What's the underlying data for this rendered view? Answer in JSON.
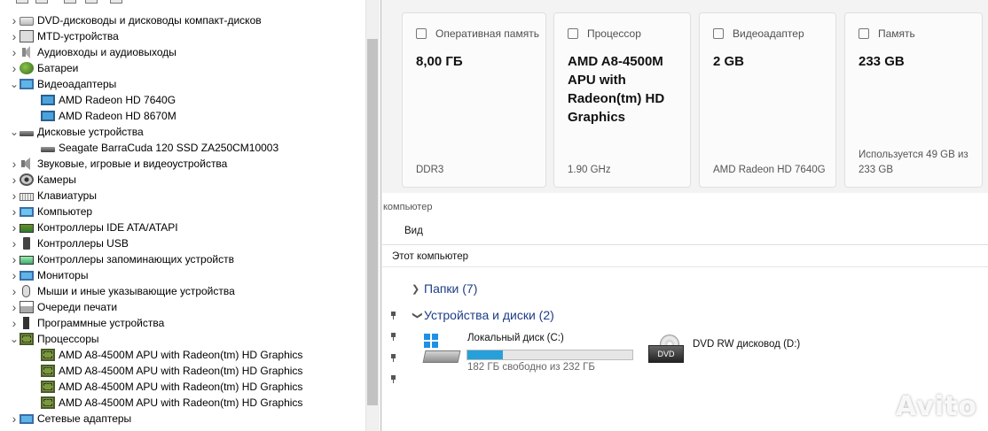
{
  "device_manager": {
    "categories": [
      {
        "label": "DVD-дисководы и дисководы компакт-дисков",
        "icon": "dvd-drive-icon",
        "expanded": false
      },
      {
        "label": "MTD-устройства",
        "icon": "mtd-icon",
        "expanded": false
      },
      {
        "label": "Аудиовходы и аудиовыходы",
        "icon": "audio-io-icon",
        "expanded": false
      },
      {
        "label": "Батареи",
        "icon": "battery-icon",
        "expanded": false
      },
      {
        "label": "Видеоадаптеры",
        "icon": "display-adapter-icon",
        "expanded": true,
        "children": [
          "AMD Radeon HD 7640G",
          "AMD Radeon HD 8670M"
        ]
      },
      {
        "label": "Дисковые устройства",
        "icon": "disk-drive-icon",
        "expanded": true,
        "children": [
          "Seagate BarraCuda 120 SSD ZA250CM10003"
        ]
      },
      {
        "label": "Звуковые, игровые и видеоустройства",
        "icon": "sound-icon",
        "expanded": false
      },
      {
        "label": "Камеры",
        "icon": "camera-icon",
        "expanded": false
      },
      {
        "label": "Клавиатуры",
        "icon": "keyboard-icon",
        "expanded": false
      },
      {
        "label": "Компьютер",
        "icon": "computer-icon",
        "expanded": false
      },
      {
        "label": "Контроллеры IDE ATA/ATAPI",
        "icon": "ide-controller-icon",
        "expanded": false
      },
      {
        "label": "Контроллеры USB",
        "icon": "usb-icon",
        "expanded": false
      },
      {
        "label": "Контроллеры запоминающих устройств",
        "icon": "storage-controller-icon",
        "expanded": false
      },
      {
        "label": "Мониторы",
        "icon": "monitor-icon",
        "expanded": false
      },
      {
        "label": "Мыши и иные указывающие устройства",
        "icon": "mouse-icon",
        "expanded": false
      },
      {
        "label": "Очереди печати",
        "icon": "print-queue-icon",
        "expanded": false
      },
      {
        "label": "Программные устройства",
        "icon": "software-device-icon",
        "expanded": false
      },
      {
        "label": "Процессоры",
        "icon": "processor-icon",
        "expanded": true,
        "children": [
          "AMD A8-4500M APU with Radeon(tm) HD Graphics",
          "AMD A8-4500M APU with Radeon(tm) HD Graphics",
          "AMD A8-4500M APU with Radeon(tm) HD Graphics",
          "AMD A8-4500M APU with Radeon(tm) HD Graphics"
        ]
      },
      {
        "label": "Сетевые адаптеры",
        "icon": "network-adapter-icon",
        "expanded": false
      }
    ]
  },
  "system_cards": [
    {
      "id": "ram",
      "title": "Оперативная память",
      "icon": "memory-icon",
      "value": "8,00 ГБ",
      "footer": "DDR3"
    },
    {
      "id": "cpu",
      "title": "Процессор",
      "icon": "processor-icon",
      "value": "AMD A8-4500M APU with Radeon(tm) HD Graphics",
      "footer": "1.90 GHz"
    },
    {
      "id": "gpu",
      "title": "Видеоадаптер",
      "icon": "video-adapter-icon",
      "value": "2 GB",
      "footer": "AMD Radeon HD 7640G"
    },
    {
      "id": "storage",
      "title": "Память",
      "icon": "storage-icon",
      "value": "233 GB",
      "footer": "Используется 49 GB из 233 GB"
    }
  ],
  "explorer": {
    "window_title": "компьютер",
    "menu_view": "Вид",
    "address": "Этот компьютер",
    "groups": {
      "folders": "Папки (7)",
      "devices": "Устройства и диски (2)"
    },
    "drives": [
      {
        "name": "Локальный диск (C:)",
        "free_text": "182 ГБ свободно из 232 ГБ",
        "used_fraction": 0.2155,
        "icon": "local-disk-icon"
      },
      {
        "name": "DVD RW дисковод (D:)",
        "icon": "dvd-rw-icon",
        "badge": "DVD"
      }
    ]
  },
  "watermark": "Avito"
}
